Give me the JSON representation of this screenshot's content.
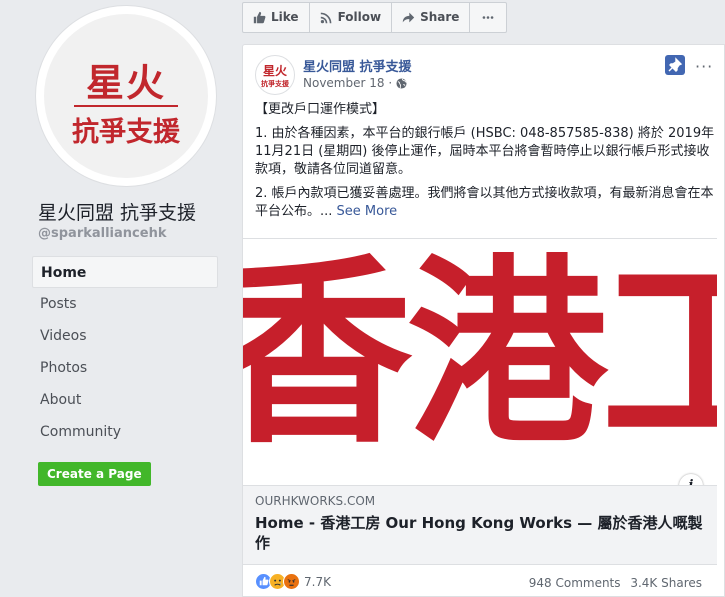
{
  "page": {
    "name": "星火同盟 抗爭支援",
    "handle": "@sparkalliancehk",
    "logo_top": "星火",
    "logo_bottom": "抗爭支援"
  },
  "nav": {
    "items": [
      "Home",
      "Posts",
      "Videos",
      "Photos",
      "About",
      "Community"
    ],
    "active": "Home"
  },
  "create_page_label": "Create a Page",
  "actions": {
    "like": "Like",
    "follow": "Follow",
    "share": "Share"
  },
  "post": {
    "author": "星火同盟 抗爭支援",
    "date": "November 18 · ",
    "heading": "【更改戶口運作模式】",
    "para1": "1. 由於各種因素，本平台的銀行帳戶 (HSBC: 048-857585-838) 將於 2019年11月21日 (星期四) 後停止運作，屆時本平台將會暫時停止以銀行帳戶形式接收款項，敬請各位同道留意。",
    "para2": "2. 帳戶內款項已獲妥善處理。我們將會以其他方式接收款項，有最新消息會在本平台公布。... ",
    "see_more": "See More",
    "image_text": "香港工",
    "link_domain": "OURHKWORKS.COM",
    "link_title": "Home - 香港工房 Our Hong Kong Works — 屬於香港人嘅製作",
    "reaction_count": "7.7K",
    "comments": "948 Comments",
    "shares": "3.4K Shares"
  },
  "colors": {
    "brand_red": "#c1272d",
    "link_blue": "#385898",
    "create_green": "#42b72a"
  }
}
